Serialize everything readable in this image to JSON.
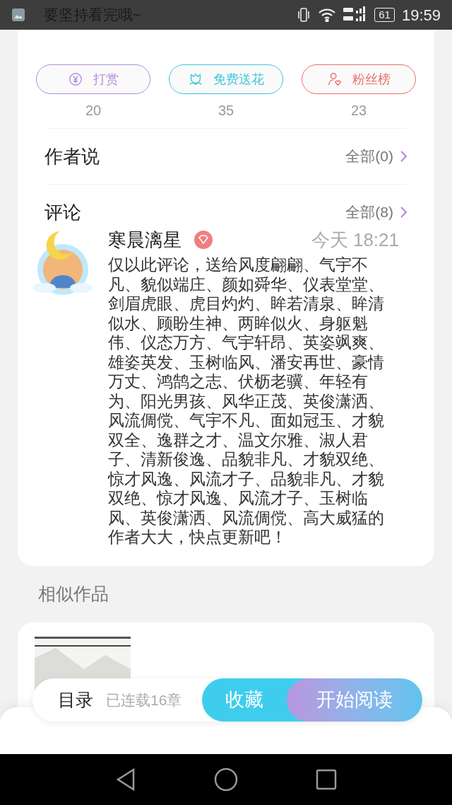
{
  "status_bar": {
    "notification": "要坚持看完哦~",
    "battery": "61",
    "time": "19:59"
  },
  "actions": [
    {
      "kind": "reward",
      "label": "打赏",
      "count": "20",
      "color": "#b48be0"
    },
    {
      "kind": "flower",
      "label": "免费送花",
      "count": "35",
      "color": "#3ec6dc"
    },
    {
      "kind": "fans",
      "label": "粉丝榜",
      "count": "23",
      "color": "#e9706c"
    }
  ],
  "author_says": {
    "title": "作者说",
    "link": "全部(0)"
  },
  "comments": {
    "title": "评论",
    "link": "全部(8)",
    "items": [
      {
        "user": "寒晨漓星",
        "vip": true,
        "time": "今天 18:21",
        "text": "仅以此评论，送给风度翩翩、气宇不凡、貌似端庄、颜如舜华、仪表堂堂、剑眉虎眼、虎目灼灼、眸若清泉、眸清似水、顾盼生神、两眸似火、身躯魁伟、仪态万方、气宇轩昂、英姿飒爽、雄姿英发、玉树临风、潘安再世、豪情万丈、鸿鹄之志、伏枥老骥、年轻有为、阳光男孩、风华正茂、英俊潇洒、风流倜傥、气宇不凡、面如冠玉、才貌双全、逸群之才、温文尔雅、淑人君子、清新俊逸、品貌非凡、才貌双绝、惊才风逸、风流才子、品貌非凡、才貌双绝、惊才风逸、风流才子、玉树临风、英俊潇洒、风流倜傥、高大威猛的作者大大，快点更新吧！"
      }
    ]
  },
  "similar": {
    "title": "相似作品"
  },
  "bottom_bar": {
    "toc": "目录",
    "progress": "已连载16章",
    "collect": "收藏",
    "read": "开始阅读"
  }
}
